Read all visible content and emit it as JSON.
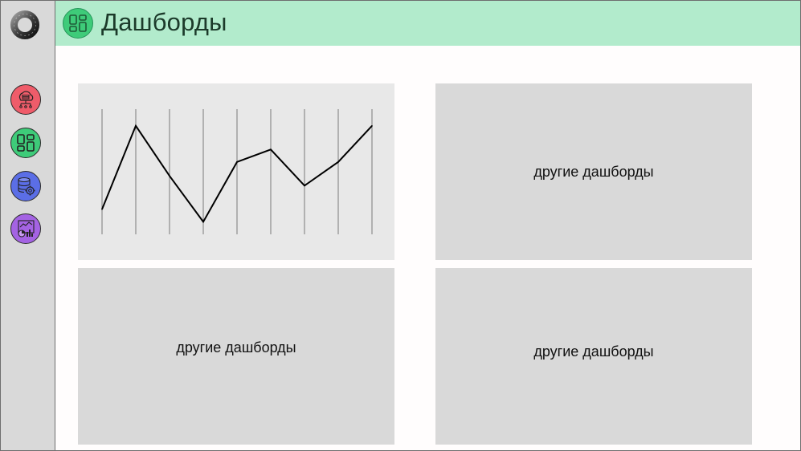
{
  "header": {
    "title": "Дашборды",
    "icon": "dashboard-grid-icon",
    "background": "#b2ebcc",
    "icon_color": "#3ecb79"
  },
  "sidebar": {
    "logo": "app-logo-ring",
    "items": [
      {
        "icon": "cloud-server-icon",
        "color": "#ef5c6a"
      },
      {
        "icon": "dashboard-grid-icon",
        "color": "#3ecb79"
      },
      {
        "icon": "database-settings-icon",
        "color": "#5b6ee6"
      },
      {
        "icon": "analytics-report-icon",
        "color": "#a463e3"
      }
    ]
  },
  "cards": {
    "top_right_label": "другие дашборды",
    "bottom_left_label": "другие дашборды",
    "bottom_right_label": "другие дашборды"
  },
  "chart_data": {
    "type": "line",
    "x": [
      1,
      2,
      3,
      4,
      5,
      6,
      7,
      8,
      9
    ],
    "series": [
      {
        "values": [
          1.8,
          7.8,
          4.2,
          0.9,
          5.2,
          6.1,
          3.5,
          5.2,
          7.8
        ]
      }
    ],
    "ylim": [
      0,
      9
    ],
    "grid": "vertical",
    "line_color": "#000000",
    "grid_color": "#7a7a7a"
  }
}
